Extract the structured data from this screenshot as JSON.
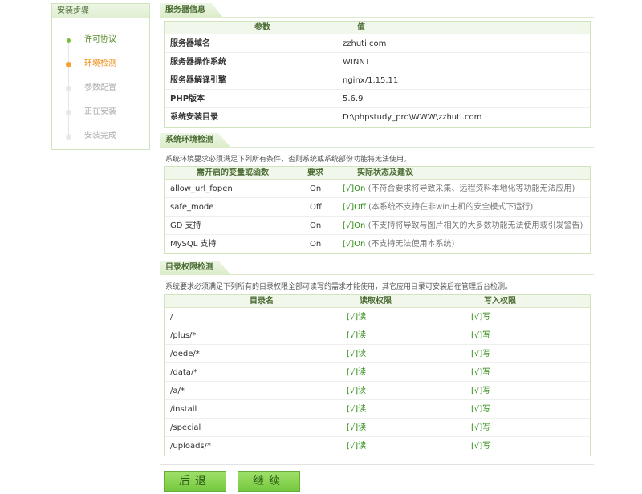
{
  "sidebar": {
    "title": "安装步骤",
    "steps": [
      {
        "label": "许可协议",
        "state": "done"
      },
      {
        "label": "环境检测",
        "state": "current"
      },
      {
        "label": "参数配置",
        "state": "pending"
      },
      {
        "label": "正在安装",
        "state": "pending"
      },
      {
        "label": "安装完成",
        "state": "pending"
      }
    ]
  },
  "server_info": {
    "title": "服务器信息",
    "headers": [
      "参数",
      "值"
    ],
    "rows": [
      [
        "服务器域名",
        "zzhuti.com"
      ],
      [
        "服务器操作系统",
        "WINNT"
      ],
      [
        "服务器解译引擎",
        "nginx/1.15.11"
      ],
      [
        "PHP版本",
        "5.6.9"
      ],
      [
        "系统安装目录",
        "D:\\phpstudy_pro\\WWW\\zzhuti.com"
      ]
    ]
  },
  "env_check": {
    "title": "系统环境检测",
    "description": "系统环境要求必须满足下列所有条件，否则系统或系统部份功能将无法使用。",
    "headers": [
      "需开启的变量或函数",
      "要求",
      "实际状态及建议"
    ],
    "rows": [
      {
        "name": "allow_url_fopen",
        "req": "On",
        "status": "[√]On",
        "note": "(不符合要求将导致采集、远程资料本地化等功能无法应用)"
      },
      {
        "name": "safe_mode",
        "req": "Off",
        "status": "[√]Off",
        "note": "(本系统不支持在非win主机的安全模式下运行)"
      },
      {
        "name": "GD 支持",
        "req": "On",
        "status": "[√]On",
        "note": "(不支持将导致与图片相关的大多数功能无法使用或引发警告)"
      },
      {
        "name": "MySQL 支持",
        "req": "On",
        "status": "[√]On",
        "note": "(不支持无法使用本系统)"
      }
    ]
  },
  "dir_check": {
    "title": "目录权限检测",
    "description": "系统要求必须满足下列所有的目录权限全部可读写的需求才能使用，其它应用目录可安装后在管理后台检测。",
    "headers": [
      "目录名",
      "读取权限",
      "写入权限"
    ],
    "rows": [
      {
        "dir": "/",
        "read": "[√]读",
        "write": "[√]写"
      },
      {
        "dir": "/plus/*",
        "read": "[√]读",
        "write": "[√]写"
      },
      {
        "dir": "/dede/*",
        "read": "[√]读",
        "write": "[√]写"
      },
      {
        "dir": "/data/*",
        "read": "[√]读",
        "write": "[√]写"
      },
      {
        "dir": "/a/*",
        "read": "[√]读",
        "write": "[√]写"
      },
      {
        "dir": "/install",
        "read": "[√]读",
        "write": "[√]写"
      },
      {
        "dir": "/special",
        "read": "[√]读",
        "write": "[√]写"
      },
      {
        "dir": "/uploads/*",
        "read": "[√]读",
        "write": "[√]写"
      }
    ]
  },
  "buttons": {
    "back": "后退",
    "next": "继续"
  },
  "colors": {
    "accent_green": "#76c93f",
    "current_orange": "#ef8b10",
    "ok_green": "#2c8a12"
  }
}
